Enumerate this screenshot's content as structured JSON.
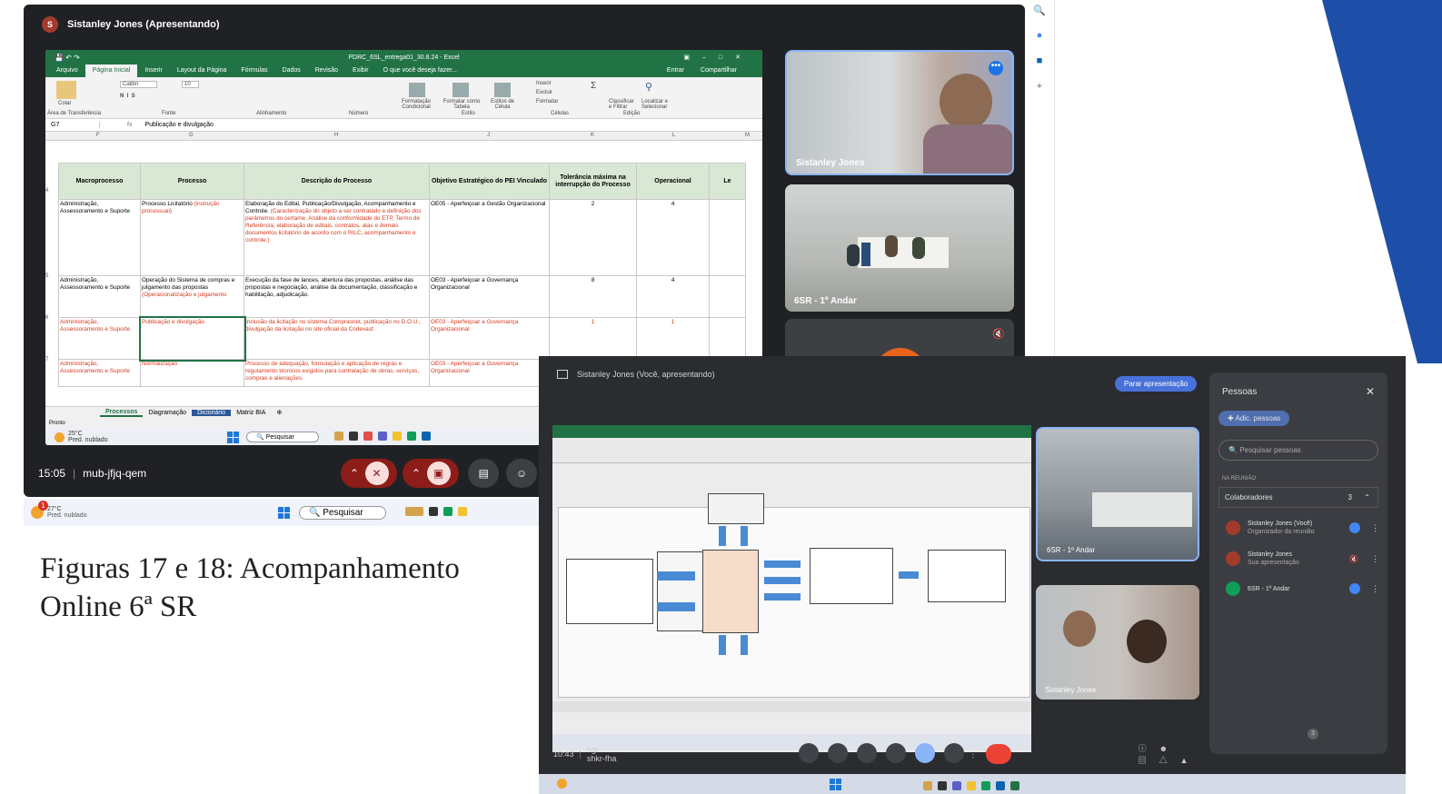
{
  "meet1": {
    "presenter_initial": "S",
    "presenter_banner": "Sistanley Jones (Apresentando)",
    "meeting_time": "15:05",
    "meeting_code": "mub-jfjq-qem",
    "tiles": [
      {
        "name": "Sistanley Jones"
      },
      {
        "name": "6SR - 1º Andar"
      }
    ]
  },
  "excel": {
    "file_title": "PDRC_6SL_entrega01_30.8.24 - Excel",
    "tabs": [
      "Arquivo",
      "Página Inicial",
      "Inserir",
      "Layout da Página",
      "Fórmulas",
      "Dados",
      "Revisão",
      "Exibir",
      "O que você deseja fazer..."
    ],
    "tabs_right": [
      "Entrar",
      "Compartilhar"
    ],
    "ribbon": {
      "paste": "Colar",
      "font": "Calibri",
      "font_size": "10",
      "groups": [
        "Área de Transferência",
        "Fonte",
        "Alinhamento",
        "Número",
        "Estilo",
        "Células",
        "Edição"
      ],
      "style_items": [
        "Formatação Condicional",
        "Formatar como Tabela",
        "Estilos de Célula"
      ],
      "cells_items": [
        "Inserir",
        "Excluir",
        "Formatar"
      ],
      "edit_items": [
        "Classificar e Filtrar",
        "Localizar e Selecionar"
      ]
    },
    "name_box": "G7",
    "formula_value": "Publicação e divulgação",
    "col_letters": [
      "F",
      "G",
      "H",
      "J",
      "K",
      "L",
      "M"
    ],
    "headers": [
      "Macroprocesso",
      "Processo",
      "Descrição do Processo",
      "Objetivo Estratégico do PEI Vinculado",
      "Tolerância máxima na interrupção do Processo",
      "Operacional",
      "Le"
    ],
    "row_numbers": [
      "4",
      "5",
      "6",
      "7"
    ],
    "rows": [
      {
        "macro": "Administração, Assessoramento e Suporte",
        "processo": "Processo Licitatório",
        "processo_red": "(instrução processual)",
        "desc": "Elaboração do Edital, Publicação/Divulgação, Acompanhamento e Controle.",
        "desc_red": "(Caracterização do objeto a ser contratado e definição dos parâmetros do certame. Análise da conformidade do ETP, Termo de Referência, elaboração de editais, contratos, atas e demais documentos licitatório de acordo com o RILC, acompanhamento e controle.)",
        "obj": "OE05 - Aperfeiçoar a Gestão Organizacional",
        "tol": "2",
        "oper": "4",
        "red": false
      },
      {
        "macro": "Administração, Assessoramento e Suporte",
        "processo": "Operação do Sistema de compras e julgamento das propostas",
        "processo_red": "(Operacionalização e julgamento",
        "desc": "Execução da fase de lances, abertura das propostas, análise das propostas e negociação, análise da documentação, classificação e habilitação, adjudicação.",
        "desc_red": "",
        "obj": "OE03 - Aperfeiçoar a Governança Organizacional",
        "tol": "8",
        "oper": "4",
        "red": false
      },
      {
        "macro": "Administração, Assessoramento e Suporte",
        "processo": "Publicação e divulgação",
        "processo_red": "",
        "desc": "Inclusão da licitação no sistema Comprasnet, publicação no D.O.U., divulgação da licitação no site oficial da Codevasf.",
        "desc_red": "",
        "obj": "OE03 - Aperfeiçoar a Governança Organizacional",
        "tol": "1",
        "oper": "1",
        "red": true
      },
      {
        "macro": "Administração, Assessoramento e Suporte",
        "processo": "Normalização",
        "processo_red": "",
        "desc": "Processo de adequação, formulação e aplicação de regras e regulamento técnicos exigidos para contratação de obras, serviços, compras e alienações.",
        "desc_red": "",
        "obj": "OE03 - Aperfeiçoar a Governança Organizacional",
        "tol": "",
        "oper": "",
        "red": true
      }
    ],
    "sheet_tabs": [
      "Processos",
      "Diagramação",
      "Dicionário",
      "Matriz BIA"
    ],
    "status": "Pronto",
    "taskbar": {
      "temp": "25°C",
      "weather": "Pred. nublado",
      "search": "Pesquisar"
    }
  },
  "win11": {
    "temp": "27°C",
    "weather": "Pred. nublado",
    "search": "Pesquisar",
    "badge": "1"
  },
  "caption": {
    "line1": "Figuras 17 e 18: Acompanhamento",
    "line2": "Online 6ª SR"
  },
  "meet2": {
    "banner": "Sistanley Jones (Você, apresentando)",
    "stop_button": "Parar apresentação",
    "people_title": "Pessoas",
    "add_people": "Adic. pessoas",
    "search_people": "Pesquisar pessoas",
    "in_meeting": "NA REUNIÃO",
    "collaborators": "Colaboradores",
    "collab_count": "3",
    "participants": [
      {
        "name": "Sistanley Jones (Você)",
        "sub": "Organizador da reunião"
      },
      {
        "name": "Sistanley Jones",
        "sub": "Sua apresentação"
      },
      {
        "name": "6SR - 1º Andar",
        "sub": ""
      }
    ],
    "tiles": [
      {
        "name": "6SR - 1º Andar"
      },
      {
        "name": "Sistanley Jones"
      }
    ],
    "meeting_time": "10:43",
    "meeting_code": "hgt-shkr-fha",
    "people_badge": "3"
  },
  "colors": {
    "excel_green": "#217346",
    "meet_dark": "#202124",
    "end_call_red": "#ea4335",
    "slide_blue": "#1e4fa8"
  }
}
